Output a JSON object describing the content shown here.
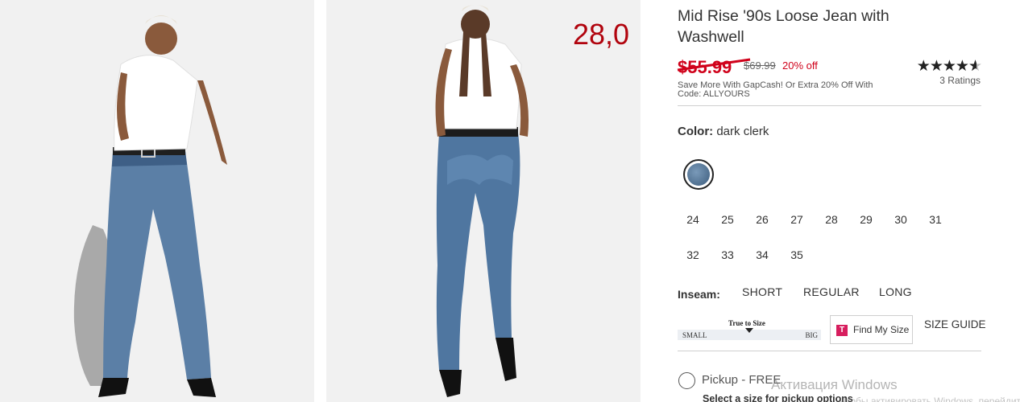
{
  "overlay_price": "28,0",
  "product": {
    "title": "Mid Rise '90s Loose Jean with Washwell",
    "sale_price": "$55.99",
    "original_price": "$69.99",
    "discount": "20% off",
    "promo": "Save More With GapCash! Or Extra 20% Off With Code: ALLYOURS",
    "rating_value": 4.5,
    "ratings_count": "3 Ratings"
  },
  "color": {
    "label": "Color:",
    "value": "dark clerk",
    "swatch_color": "#5a7a9a"
  },
  "sizes": [
    "24",
    "25",
    "26",
    "27",
    "28",
    "29",
    "30",
    "31",
    "32",
    "33",
    "34",
    "35"
  ],
  "inseam": {
    "label": "Inseam:",
    "options": [
      "SHORT",
      "REGULAR",
      "LONG"
    ]
  },
  "fit": {
    "title": "True to Size",
    "small": "SMALL",
    "big": "BIG",
    "level": 0.5
  },
  "find_my_size": {
    "logo": "T",
    "label": "Find My Size"
  },
  "size_guide": "SIZE GUIDE",
  "pickup": {
    "label": "Pickup - FREE",
    "sub": "Select a size for pickup options"
  },
  "watermark": {
    "title": "Активация Windows",
    "sub": "Чтобы активировать Windows, перейдите в"
  },
  "colors": {
    "sale_red": "#d0021b",
    "overlay_red": "#b1040e",
    "denim": "#4f6f8f",
    "tlogo_pink": "#d71e5e"
  }
}
